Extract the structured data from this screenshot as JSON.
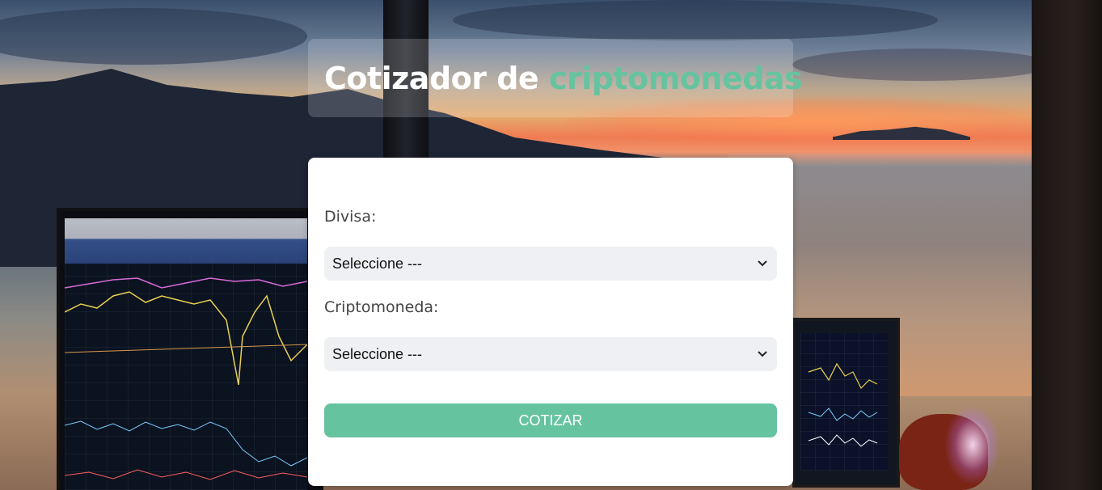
{
  "header": {
    "title_prefix": "Cotizador de",
    "title_accent": "criptomonedas"
  },
  "form": {
    "currency_label": "Divisa:",
    "currency_selected": "Seleccione ---",
    "crypto_label": "Criptomoneda:",
    "crypto_selected": "Seleccione ---",
    "submit_label": "COTIZAR"
  },
  "colors": {
    "accent": "#66c3a0",
    "select_bg": "#eff0f4",
    "card_bg": "#ffffff"
  },
  "icons": {
    "select_chevron": "chevron-down-icon"
  }
}
